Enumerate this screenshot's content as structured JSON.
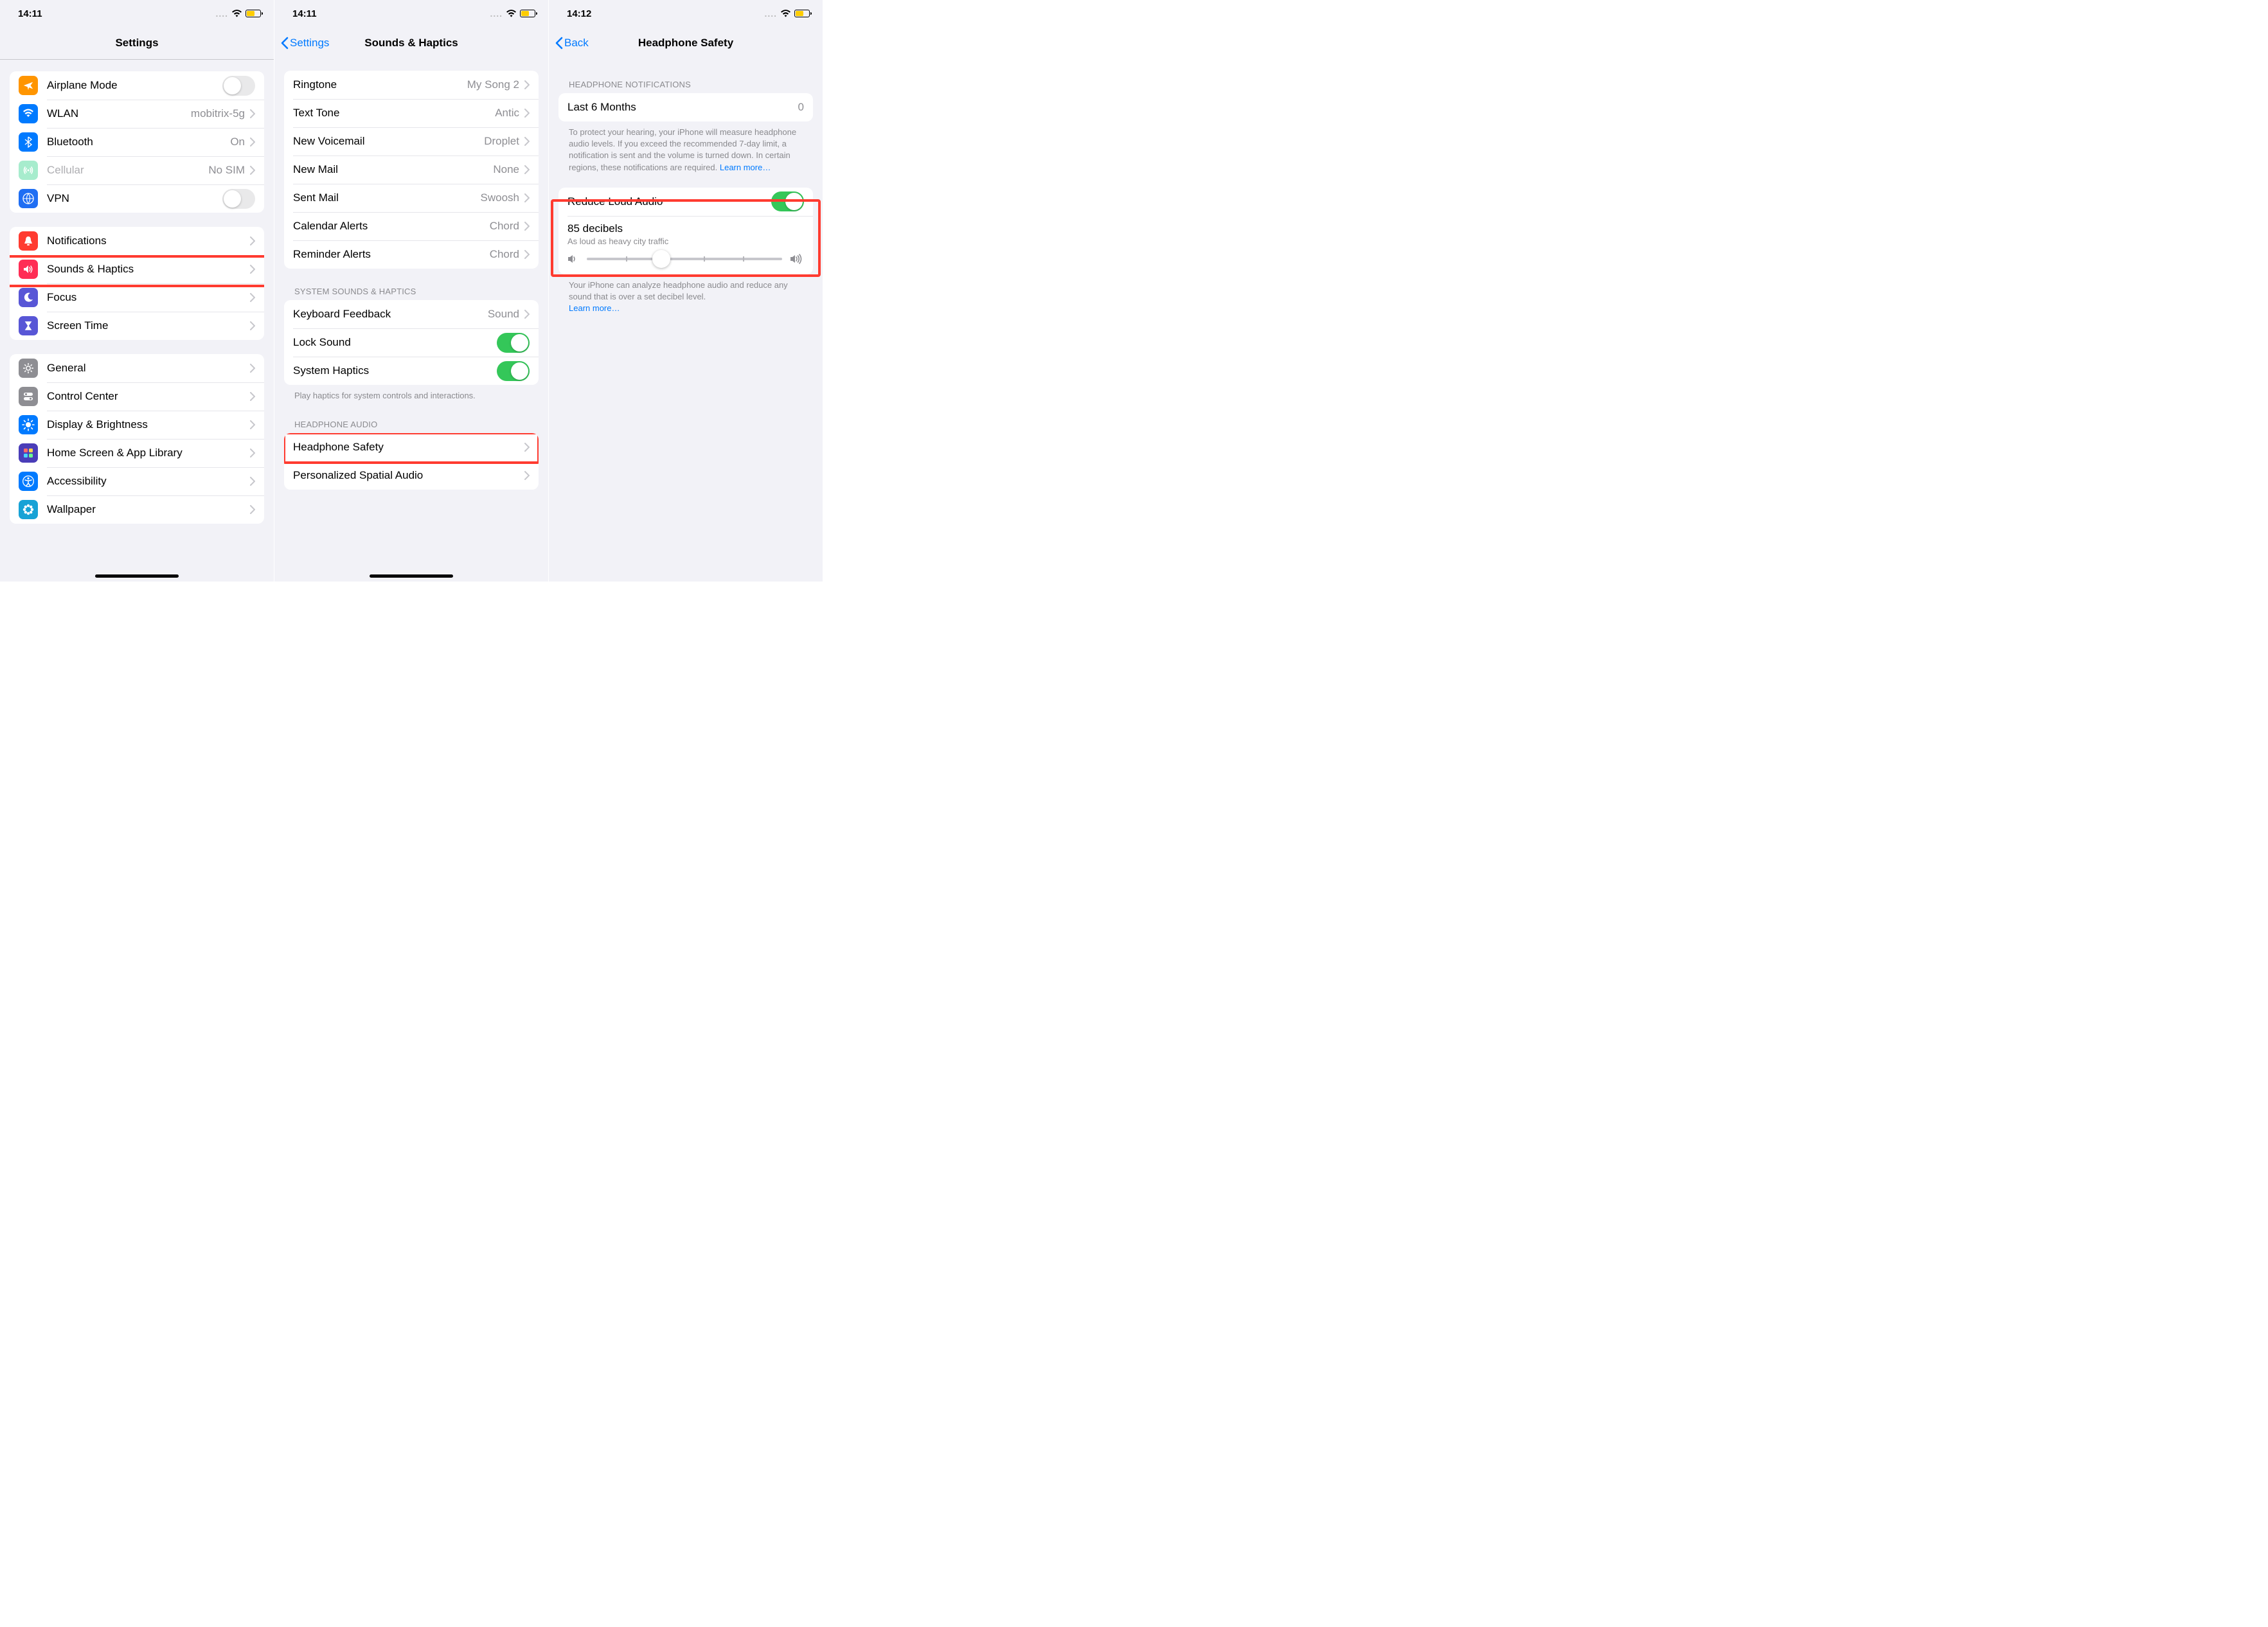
{
  "status": {
    "time_a": "14:11",
    "time_b": "14:11",
    "time_c": "14:12",
    "dots": "....",
    "wifi": "wifi",
    "battery_pct": 55
  },
  "colors": {
    "orange": "#ff9500",
    "blue": "#007aff",
    "green": "#34c759",
    "lightgreen": "#a7eccd",
    "globeblue": "#1f6ef3",
    "red": "#ff3b30",
    "pink": "#ff2d55",
    "purple": "#5856d6",
    "grey": "#8e8e93",
    "darkgrey": "#55555a",
    "teal": "#17a2d6"
  },
  "p1": {
    "title": "Settings",
    "groups": {
      "g1": [
        {
          "icon": "airplane",
          "bg": "orange",
          "label": "Airplane Mode",
          "toggle": false,
          "grey": false
        },
        {
          "icon": "wifi",
          "bg": "blue",
          "label": "WLAN",
          "value": "mobitrix-5g",
          "chev": true
        },
        {
          "icon": "bluetooth",
          "bg": "blue",
          "label": "Bluetooth",
          "value": "On",
          "chev": true
        },
        {
          "icon": "cellular",
          "bg": "lightgreen",
          "label": "Cellular",
          "value": "No SIM",
          "chev": true,
          "grey": true
        },
        {
          "icon": "vpn",
          "bg": "globeblue",
          "label": "VPN",
          "toggle": false
        }
      ],
      "g2": [
        {
          "icon": "bell",
          "bg": "red",
          "label": "Notifications",
          "chev": true
        },
        {
          "icon": "speaker",
          "bg": "pink",
          "label": "Sounds & Haptics",
          "chev": true,
          "highlight": true
        },
        {
          "icon": "moon",
          "bg": "purple",
          "label": "Focus",
          "chev": true
        },
        {
          "icon": "hourglass",
          "bg": "purple",
          "label": "Screen Time",
          "chev": true
        }
      ],
      "g3": [
        {
          "icon": "gear",
          "bg": "grey",
          "label": "General",
          "chev": true
        },
        {
          "icon": "switches",
          "bg": "darkgrey",
          "label": "Control Center",
          "chev": true
        },
        {
          "icon": "sun",
          "bg": "blue",
          "label": "Display & Brightness",
          "chev": true
        },
        {
          "icon": "apps",
          "bg": "purple",
          "label": "Home Screen & App Library",
          "chev": true
        },
        {
          "icon": "person",
          "bg": "blue",
          "label": "Accessibility",
          "chev": true
        },
        {
          "icon": "flower",
          "bg": "teal",
          "label": "Wallpaper",
          "chev": true
        }
      ]
    }
  },
  "p2": {
    "back": "Settings",
    "title": "Sounds & Haptics",
    "g1": [
      {
        "label": "Ringtone",
        "value": "My Song 2",
        "chev": true
      },
      {
        "label": "Text Tone",
        "value": "Antic",
        "chev": true
      },
      {
        "label": "New Voicemail",
        "value": "Droplet",
        "chev": true
      },
      {
        "label": "New Mail",
        "value": "None",
        "chev": true
      },
      {
        "label": "Sent Mail",
        "value": "Swoosh",
        "chev": true
      },
      {
        "label": "Calendar Alerts",
        "value": "Chord",
        "chev": true
      },
      {
        "label": "Reminder Alerts",
        "value": "Chord",
        "chev": true
      }
    ],
    "h2": "SYSTEM SOUNDS & HAPTICS",
    "g2": [
      {
        "label": "Keyboard Feedback",
        "value": "Sound",
        "chev": true
      },
      {
        "label": "Lock Sound",
        "toggle": true
      },
      {
        "label": "System Haptics",
        "toggle": true
      }
    ],
    "f2": "Play haptics for system controls and interactions.",
    "h3": "HEADPHONE AUDIO",
    "g3": [
      {
        "label": "Headphone Safety",
        "chev": true,
        "highlight": true
      },
      {
        "label": "Personalized Spatial Audio",
        "chev": true
      }
    ]
  },
  "p3": {
    "back": "Back",
    "title": "Headphone Safety",
    "h1": "HEADPHONE NOTIFICATIONS",
    "g1": {
      "label": "Last 6 Months",
      "value": "0"
    },
    "f1": "To protect your hearing, your iPhone will measure headphone audio levels. If you exceed the recommended 7-day limit, a notification is sent and the volume is turned down. In certain regions, these notifications are required. ",
    "learn": "Learn more…",
    "g2": {
      "reduce_label": "Reduce Loud Audio",
      "reduce_on": true,
      "decibels_title": "85 decibels",
      "decibels_sub": "As loud as heavy city traffic",
      "slider_pct": 38
    },
    "f2": "Your iPhone can analyze headphone audio and reduce any sound that is over a set decibel level. "
  }
}
